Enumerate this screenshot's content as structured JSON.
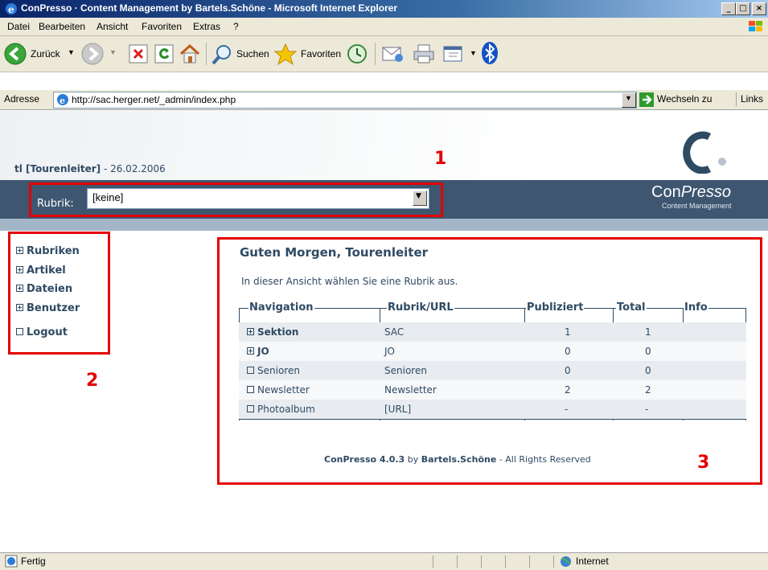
{
  "window": {
    "title": "ConPresso · Content Management by Bartels.Schöne - Microsoft Internet Explorer",
    "controls": [
      "_",
      "□",
      "×"
    ]
  },
  "menubar": {
    "items": [
      "Datei",
      "Bearbeiten",
      "Ansicht",
      "Favoriten",
      "Extras",
      "?"
    ]
  },
  "toolbar": {
    "back_label": "Zurück",
    "search_label": "Suchen",
    "favorites_label": "Favoriten"
  },
  "addressbar": {
    "label": "Adresse",
    "url": "http://sac.herger.net/_admin/index.php",
    "go_label": "Wechseln zu",
    "links_label": "Links"
  },
  "header": {
    "user": "tl [Tourenleiter]",
    "date": " - 26.02.2006",
    "rubrik_label": "Rubrik:",
    "rubrik_value": "[keine]",
    "brand_con": "Con",
    "brand_presso": "Presso",
    "brand_sub": "Content Management"
  },
  "sidebar": {
    "items": [
      {
        "label": "Rubriken",
        "icon": "plus-box-icon"
      },
      {
        "label": "Artikel",
        "icon": "plus-box-icon"
      },
      {
        "label": "Dateien",
        "icon": "plus-box-icon"
      },
      {
        "label": "Benutzer",
        "icon": "plus-box-icon"
      },
      {
        "label": "Logout",
        "icon": "empty-box-icon"
      }
    ]
  },
  "main": {
    "greeting": "Guten Morgen, Tourenleiter",
    "instruction": "In dieser Ansicht wählen Sie eine Rubrik aus.",
    "table": {
      "headers": [
        "Navigation",
        "Rubrik/URL",
        "Publiziert",
        "Total",
        "Info"
      ],
      "rows": [
        {
          "name": "Sektion",
          "url": "SAC",
          "publiziert": "1",
          "total": "1",
          "info": "",
          "expandable": true,
          "bold": true
        },
        {
          "name": "JO",
          "url": "JO",
          "publiziert": "0",
          "total": "0",
          "info": "",
          "expandable": true,
          "bold": true
        },
        {
          "name": "Senioren",
          "url": "Senioren",
          "publiziert": "0",
          "total": "0",
          "info": "",
          "expandable": false,
          "bold": false
        },
        {
          "name": "Newsletter",
          "url": "Newsletter",
          "publiziert": "2",
          "total": "2",
          "info": "",
          "expandable": false,
          "bold": false
        },
        {
          "name": "Photoalbum",
          "url": "[URL]",
          "publiziert": "-",
          "total": "-",
          "info": "",
          "expandable": false,
          "bold": false
        }
      ]
    },
    "footer": {
      "product": "ConPresso 4.0.3",
      "by": " by ",
      "company": "Bartels.Schöne",
      "rights": " - All Rights Reserved"
    }
  },
  "annotations": {
    "box1": "1",
    "box2": "2",
    "box3": "3",
    "color": "#e30000"
  },
  "statusbar": {
    "status": "Fertig",
    "zone": "Internet"
  },
  "colors": {
    "header_band": "#3e5670",
    "text_primary": "#2f4a63",
    "row_alt": "#e8ecf0",
    "row_plain": "#f7f8fa"
  }
}
